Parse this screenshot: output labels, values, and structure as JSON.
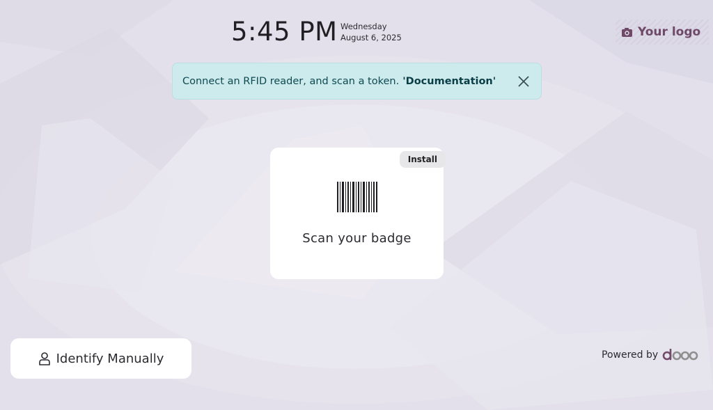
{
  "clock": {
    "time": "5:45 PM",
    "weekday": "Wednesday",
    "date": "August 6, 2025"
  },
  "logo": {
    "text": "Your logo",
    "icon": "camera-icon"
  },
  "alert": {
    "message": "Connect an RFID reader, and scan a token.",
    "link": "'Documentation'",
    "close_icon": "close-icon"
  },
  "badge_card": {
    "install_label": "Install",
    "icon": "barcode-icon",
    "label": "Scan your badge"
  },
  "identify": {
    "label": "Identify Manually",
    "icon": "user-icon"
  },
  "footer": {
    "powered_by": "Powered by",
    "brand": "odoo"
  },
  "colors": {
    "background": "#e2dfea",
    "alert_bg": "#cdeaec",
    "alert_text": "#0e4a52",
    "brand_purple": "#714b67",
    "card_bg": "#ffffff"
  }
}
